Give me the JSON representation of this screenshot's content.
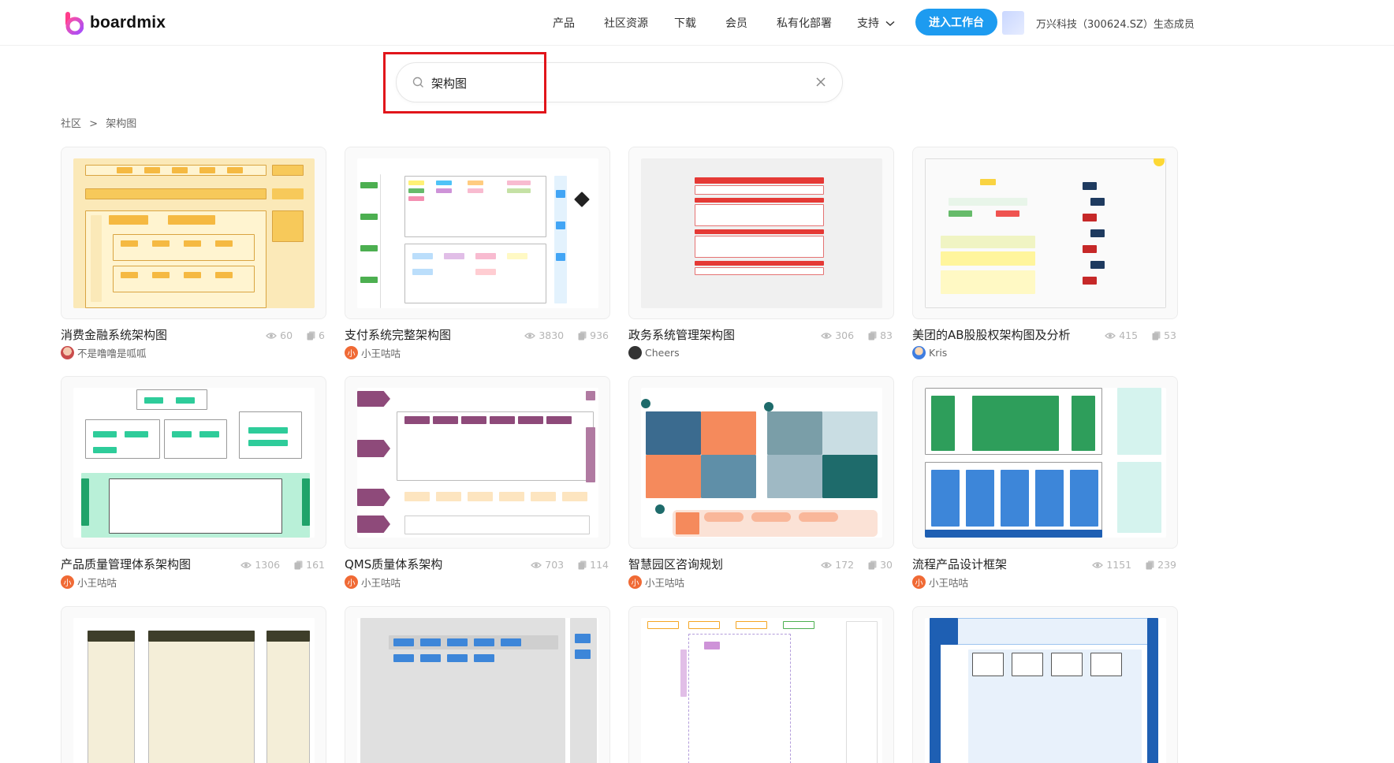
{
  "header": {
    "brand": "boardmix",
    "nav": [
      {
        "label": "产品"
      },
      {
        "label": "社区资源"
      },
      {
        "label": "下载"
      },
      {
        "label": "会员"
      },
      {
        "label": "私有化部署"
      },
      {
        "label": "支持"
      }
    ],
    "cta_label": "进入工作台",
    "partner_text": "万兴科技（300624.SZ）生态成员"
  },
  "search": {
    "value": "架构图",
    "icon": "search-icon",
    "clear_icon": "close-icon"
  },
  "breadcrumb": {
    "root": "社区",
    "separator": ">",
    "current": "架构图"
  },
  "cards": [
    {
      "title": "消费金融系统架构图",
      "views": "60",
      "copies": "6",
      "author": "不是噜噜是呱呱"
    },
    {
      "title": "支付系统完整架构图",
      "views": "3830",
      "copies": "936",
      "author": "小王咕咕"
    },
    {
      "title": "政务系统管理架构图",
      "views": "306",
      "copies": "83",
      "author": "Cheers"
    },
    {
      "title": "美团的AB股股权架构图及分析",
      "views": "415",
      "copies": "53",
      "author": "Kris"
    },
    {
      "title": "产品质量管理体系架构图",
      "views": "1306",
      "copies": "161",
      "author": "小王咕咕"
    },
    {
      "title": "QMS质量体系架构",
      "views": "703",
      "copies": "114",
      "author": "小王咕咕"
    },
    {
      "title": "智慧园区咨询规划",
      "views": "172",
      "copies": "30",
      "author": "小王咕咕"
    },
    {
      "title": "流程产品设计框架",
      "views": "1151",
      "copies": "239",
      "author": "小王咕咕"
    }
  ],
  "avatar_initial": "小",
  "colors": {
    "accent": "#1d9bf0",
    "highlight_box": "#e1151b",
    "stats": "#b5b5b5"
  }
}
